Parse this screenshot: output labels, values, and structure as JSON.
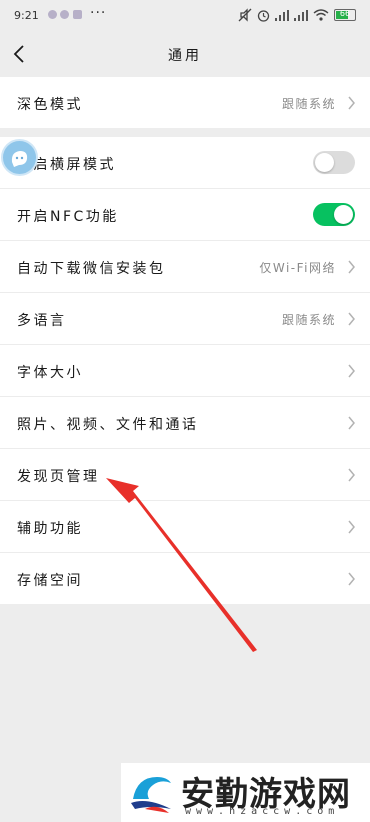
{
  "status_bar": {
    "time": "9:21",
    "more": "···",
    "battery": "66",
    "battery_level": 0.66,
    "network_badges": [
      "HD",
      "HD"
    ]
  },
  "nav": {
    "title": "通用",
    "back_icon": "chevron-left-icon"
  },
  "groups": [
    {
      "rows": [
        {
          "label": "深色模式",
          "value": "跟随系统",
          "control": "chevron"
        }
      ]
    },
    {
      "rows": [
        {
          "label": "开启横屏模式",
          "control": "toggle",
          "on": false
        },
        {
          "label": "开启NFC功能",
          "control": "toggle",
          "on": true
        },
        {
          "label": "自动下载微信安装包",
          "value": "仅Wi-Fi网络",
          "control": "chevron"
        },
        {
          "label": "多语言",
          "value": "跟随系统",
          "control": "chevron"
        },
        {
          "label": "字体大小",
          "control": "chevron"
        },
        {
          "label": "照片、视频、文件和通话",
          "control": "chevron"
        },
        {
          "label": "发现页管理",
          "control": "chevron"
        },
        {
          "label": "辅助功能",
          "control": "chevron"
        },
        {
          "label": "存储空间",
          "control": "chevron"
        }
      ]
    }
  ],
  "colors": {
    "toggle_on": "#07c160",
    "toggle_off": "#dcdcdc",
    "annotation_arrow": "#e8302a",
    "background": "#ededed"
  },
  "overlay": {
    "floating_bubble_icon": "assistant-bubble-icon",
    "arrow_icon": "red-arrow-annotation"
  },
  "watermark": {
    "title": "安勤游戏网",
    "url": "www.hzaccw.com"
  }
}
